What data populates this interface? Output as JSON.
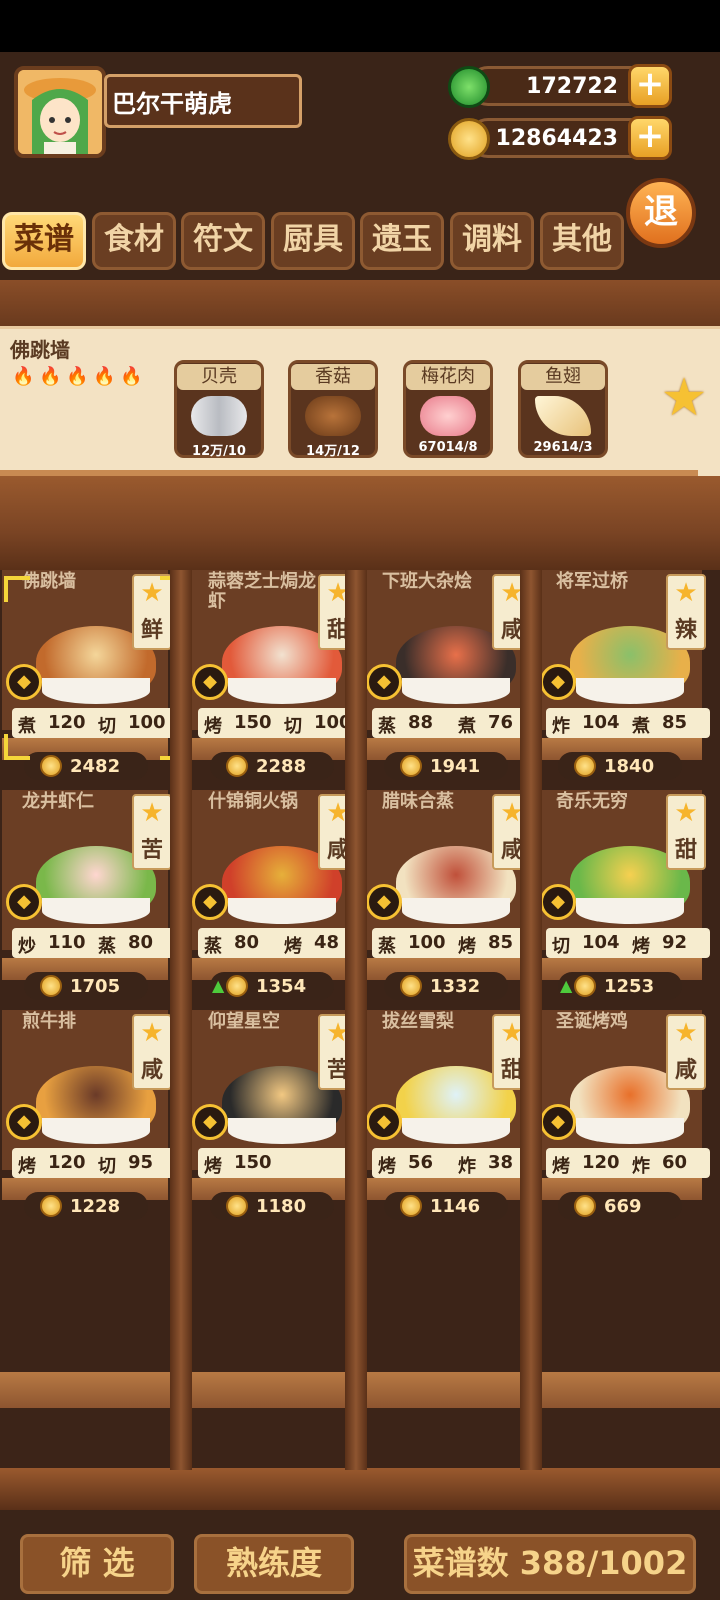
{
  "player": {
    "name": "巴尔干萌虎"
  },
  "resources": [
    {
      "value": "172722",
      "icon": "jade-icon"
    },
    {
      "value": "12864423",
      "icon": "coin-icon"
    }
  ],
  "exit_label": "退",
  "tabs": [
    {
      "label": "菜谱",
      "active": true
    },
    {
      "label": "食材"
    },
    {
      "label": "符文"
    },
    {
      "label": "厨具"
    },
    {
      "label": "遗玉"
    },
    {
      "label": "调料"
    },
    {
      "label": "其他"
    }
  ],
  "selected_recipe": {
    "name": "佛跳墙",
    "flames": 5,
    "ingredients": [
      {
        "name": "贝壳",
        "qty": "12万/10"
      },
      {
        "name": "香菇",
        "qty": "14万/12"
      },
      {
        "name": "梅花肉",
        "qty": "67014/8"
      },
      {
        "name": "鱼翅",
        "qty": "29614/3"
      }
    ]
  },
  "recipes": [
    {
      "name": "佛跳墙",
      "flavor": "鲜",
      "skills": [
        [
          "煮",
          "120"
        ],
        [
          "切",
          "100"
        ]
      ],
      "price": "2482",
      "up": false
    },
    {
      "name": "蒜蓉芝士焗龙虾",
      "flavor": "甜",
      "skills": [
        [
          "烤",
          "150"
        ],
        [
          "切",
          "100"
        ]
      ],
      "price": "2288",
      "up": false
    },
    {
      "name": "下班大杂烩",
      "flavor": "咸",
      "skills": [
        [
          "蒸",
          "88"
        ],
        [
          "煮",
          "76"
        ]
      ],
      "price": "1941",
      "up": false
    },
    {
      "name": "将军过桥",
      "flavor": "辣",
      "skills": [
        [
          "炸",
          "104"
        ],
        [
          "煮",
          "85"
        ]
      ],
      "price": "1840",
      "up": false
    },
    {
      "name": "龙井虾仁",
      "flavor": "苦",
      "skills": [
        [
          "炒",
          "110"
        ],
        [
          "蒸",
          "80"
        ]
      ],
      "price": "1705",
      "up": false
    },
    {
      "name": "什锦铜火锅",
      "flavor": "咸",
      "skills": [
        [
          "蒸",
          "80"
        ],
        [
          "烤",
          "48"
        ]
      ],
      "price": "1354",
      "up": true
    },
    {
      "name": "腊味合蒸",
      "flavor": "咸",
      "skills": [
        [
          "蒸",
          "100"
        ],
        [
          "烤",
          "85"
        ]
      ],
      "price": "1332",
      "up": false
    },
    {
      "name": "奇乐无穷",
      "flavor": "甜",
      "skills": [
        [
          "切",
          "104"
        ],
        [
          "烤",
          "92"
        ]
      ],
      "price": "1253",
      "up": true
    },
    {
      "name": "煎牛排",
      "flavor": "咸",
      "skills": [
        [
          "烤",
          "120"
        ],
        [
          "切",
          "95"
        ]
      ],
      "price": "1228",
      "up": false
    },
    {
      "name": "仰望星空",
      "flavor": "苦",
      "skills": [
        [
          "烤",
          "150"
        ]
      ],
      "price": "1180",
      "up": false
    },
    {
      "name": "拔丝雪梨",
      "flavor": "甜",
      "skills": [
        [
          "烤",
          "56"
        ],
        [
          "炸",
          "38"
        ]
      ],
      "price": "1146",
      "up": false
    },
    {
      "name": "圣诞烤鸡",
      "flavor": "咸",
      "skills": [
        [
          "烤",
          "120"
        ],
        [
          "炸",
          "60"
        ]
      ],
      "price": "669",
      "up": false
    }
  ],
  "bottom": {
    "filter_label": "筛 选",
    "proficiency_label": "熟练度",
    "recipe_count_label": "菜谱数 388/1002"
  }
}
